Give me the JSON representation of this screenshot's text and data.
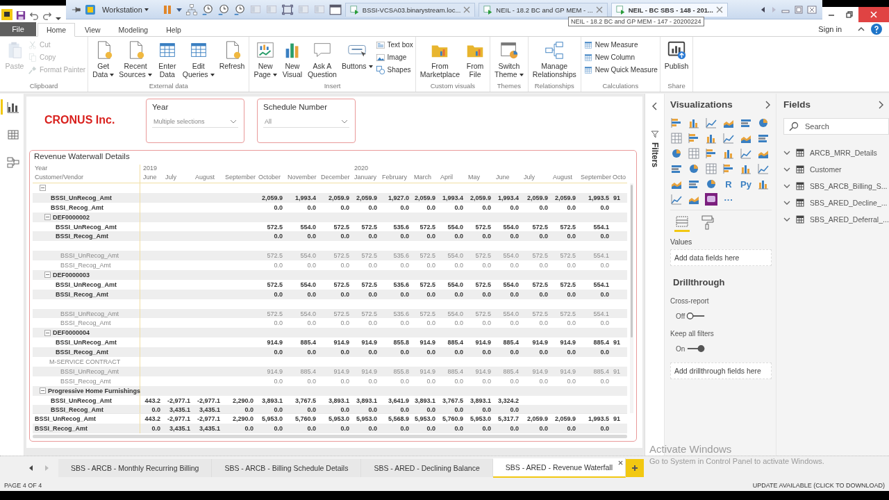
{
  "vm_toolbar": {
    "menu": "Workstation",
    "tabs": [
      {
        "label": "BSSI-VCSA03.binarystream.loc...",
        "selected": false
      },
      {
        "label": "NEIL - 18.2 BC and GP MEM - ...",
        "selected": false
      },
      {
        "label": "NEIL - BC SBS - 148 - 201...",
        "selected": true
      }
    ],
    "tooltip": "NEIL - 18.2 BC and GP MEM - 147 - 20200224"
  },
  "ribbon": {
    "tabs": [
      {
        "label": "File",
        "kind": "file",
        "selected": false
      },
      {
        "label": "Home",
        "kind": "tab",
        "selected": true
      },
      {
        "label": "View",
        "kind": "tab",
        "selected": false
      },
      {
        "label": "Modeling",
        "kind": "tab",
        "selected": false
      },
      {
        "label": "Help",
        "kind": "tab",
        "selected": false
      }
    ],
    "sign_in": "Sign in",
    "groups": [
      {
        "label": "Clipboard",
        "items": [
          {
            "kind": "large",
            "label": "Paste",
            "disabled": true,
            "dropdown": false
          },
          {
            "kind": "stack",
            "items": [
              {
                "label": "Cut",
                "disabled": true
              },
              {
                "label": "Copy",
                "disabled": true
              },
              {
                "label": "Format Painter",
                "disabled": true
              }
            ]
          }
        ]
      },
      {
        "label": "External data",
        "items": [
          {
            "kind": "large",
            "label": "Get\nData",
            "disabled": false,
            "dropdown": true
          },
          {
            "kind": "large",
            "label": "Recent\nSources",
            "disabled": false,
            "dropdown": true
          },
          {
            "kind": "large",
            "label": "Enter\nData",
            "disabled": false,
            "dropdown": false
          },
          {
            "kind": "large",
            "label": "Edit\nQueries",
            "disabled": false,
            "dropdown": true
          },
          {
            "kind": "large",
            "label": "Refresh",
            "disabled": false,
            "dropdown": false
          }
        ]
      },
      {
        "label": "Insert",
        "items": [
          {
            "kind": "large",
            "label": "New\nPage",
            "disabled": false,
            "dropdown": true
          },
          {
            "kind": "large",
            "label": "New\nVisual",
            "disabled": false,
            "dropdown": false
          },
          {
            "kind": "large",
            "label": "Ask A\nQuestion",
            "disabled": false,
            "dropdown": false
          },
          {
            "kind": "large",
            "label": "Buttons",
            "disabled": false,
            "dropdown": true
          },
          {
            "kind": "stack",
            "items": [
              {
                "label": "Text box",
                "disabled": false
              },
              {
                "label": "Image",
                "disabled": false
              },
              {
                "label": "Shapes",
                "disabled": false
              }
            ]
          }
        ]
      },
      {
        "label": "Custom visuals",
        "items": [
          {
            "kind": "large",
            "label": "From\nMarketplace",
            "disabled": false,
            "dropdown": false
          },
          {
            "kind": "large",
            "label": "From\nFile",
            "disabled": false,
            "dropdown": false
          }
        ]
      },
      {
        "label": "Themes",
        "items": [
          {
            "kind": "large",
            "label": "Switch\nTheme",
            "disabled": false,
            "dropdown": true
          }
        ]
      },
      {
        "label": "Relationships",
        "items": [
          {
            "kind": "large",
            "label": "Manage\nRelationships",
            "disabled": false,
            "dropdown": false
          }
        ]
      },
      {
        "label": "Calculations",
        "items": [
          {
            "kind": "stack",
            "items": [
              {
                "label": "New Measure",
                "disabled": false
              },
              {
                "label": "New Column",
                "disabled": false
              },
              {
                "label": "New Quick Measure",
                "disabled": false
              }
            ]
          }
        ]
      },
      {
        "label": "Share",
        "items": [
          {
            "kind": "large",
            "label": "Publish",
            "disabled": false,
            "dropdown": false
          }
        ]
      }
    ]
  },
  "views": [
    {
      "selected": true
    },
    {
      "selected": false
    },
    {
      "selected": false
    }
  ],
  "canvas": {
    "logo": "CRONUS Inc.",
    "slicers": [
      {
        "title": "Year",
        "value": "Multiple selections"
      },
      {
        "title": "Schedule Number",
        "value": "All"
      }
    ],
    "matrix": {
      "title": "Revenue Waterwall Details",
      "row_headers": [
        "Year",
        "Customer/Vendor"
      ],
      "columns": [
        {
          "month": "June",
          "year": "2019"
        },
        {
          "month": "July"
        },
        {
          "month": "August"
        },
        {
          "month": "September"
        },
        {
          "month": "October"
        },
        {
          "month": "November"
        },
        {
          "month": "December"
        },
        {
          "month": "January",
          "year": "2020"
        },
        {
          "month": "February"
        },
        {
          "month": "March"
        },
        {
          "month": "April"
        },
        {
          "month": "May"
        },
        {
          "month": "June"
        },
        {
          "month": "July"
        },
        {
          "month": "August"
        },
        {
          "month": "September"
        },
        {
          "month": "Octo"
        }
      ],
      "rows": [
        {
          "kind": "group",
          "expanded": true,
          "measures": [
            {
              "label": "BSSI_UnRecog_Amt",
              "cells": [
                null,
                null,
                null,
                null,
                "2,059.9",
                "1,993.4",
                "2,059.9",
                "2,059.9",
                "1,927.0",
                "2,059.9",
                "1,993.4",
                "2,059.9",
                "1,993.4",
                "2,059.9",
                "2,059.9",
                "1,993.5",
                "91"
              ]
            },
            {
              "label": "BSSI_Recog_Amt",
              "cells": [
                null,
                null,
                null,
                null,
                "0.0",
                "0.0",
                "0.0",
                "0.0",
                "0.0",
                "0.0",
                "0.0",
                "0.0",
                "0.0",
                "0.0",
                "0.0",
                "0.0",
                null
              ]
            }
          ],
          "children": [
            {
              "kind": "group",
              "label": "DEF0000002",
              "expanded": true,
              "measures": [
                {
                  "label": "BSSI_UnRecog_Amt",
                  "cells": [
                    null,
                    null,
                    null,
                    null,
                    "572.5",
                    "554.0",
                    "572.5",
                    "572.5",
                    "535.6",
                    "572.5",
                    "554.0",
                    "572.5",
                    "554.0",
                    "572.5",
                    "572.5",
                    "554.1",
                    null
                  ]
                },
                {
                  "label": "BSSI_Recog_Amt",
                  "cells": [
                    null,
                    null,
                    null,
                    null,
                    "0.0",
                    "0.0",
                    "0.0",
                    "0.0",
                    "0.0",
                    "0.0",
                    "0.0",
                    "0.0",
                    "0.0",
                    "0.0",
                    "0.0",
                    "0.0",
                    null
                  ]
                }
              ],
              "children": [
                {
                  "kind": "leaf",
                  "measures": [
                    {
                      "label": "BSSI_UnRecog_Amt",
                      "cells": [
                        null,
                        null,
                        null,
                        null,
                        "572.5",
                        "554.0",
                        "572.5",
                        "572.5",
                        "535.6",
                        "572.5",
                        "554.0",
                        "572.5",
                        "554.0",
                        "572.5",
                        "572.5",
                        "554.1",
                        null
                      ]
                    },
                    {
                      "label": "BSSI_Recog_Amt",
                      "cells": [
                        null,
                        null,
                        null,
                        null,
                        "0.0",
                        "0.0",
                        "0.0",
                        "0.0",
                        "0.0",
                        "0.0",
                        "0.0",
                        "0.0",
                        "0.0",
                        "0.0",
                        "0.0",
                        "0.0",
                        null
                      ]
                    }
                  ]
                }
              ]
            },
            {
              "kind": "group",
              "label": "DEF0000003",
              "expanded": true,
              "measures": [
                {
                  "label": "BSSI_UnRecog_Amt",
                  "cells": [
                    null,
                    null,
                    null,
                    null,
                    "572.5",
                    "554.0",
                    "572.5",
                    "572.5",
                    "535.6",
                    "572.5",
                    "554.0",
                    "572.5",
                    "554.0",
                    "572.5",
                    "572.5",
                    "554.1",
                    null
                  ]
                },
                {
                  "label": "BSSI_Recog_Amt",
                  "cells": [
                    null,
                    null,
                    null,
                    null,
                    "0.0",
                    "0.0",
                    "0.0",
                    "0.0",
                    "0.0",
                    "0.0",
                    "0.0",
                    "0.0",
                    "0.0",
                    "0.0",
                    "0.0",
                    "0.0",
                    null
                  ]
                }
              ],
              "children": [
                {
                  "kind": "leaf",
                  "measures": [
                    {
                      "label": "BSSI_UnRecog_Amt",
                      "cells": [
                        null,
                        null,
                        null,
                        null,
                        "572.5",
                        "554.0",
                        "572.5",
                        "572.5",
                        "535.6",
                        "572.5",
                        "554.0",
                        "572.5",
                        "554.0",
                        "572.5",
                        "572.5",
                        "554.1",
                        null
                      ]
                    },
                    {
                      "label": "BSSI_Recog_Amt",
                      "cells": [
                        null,
                        null,
                        null,
                        null,
                        "0.0",
                        "0.0",
                        "0.0",
                        "0.0",
                        "0.0",
                        "0.0",
                        "0.0",
                        "0.0",
                        "0.0",
                        "0.0",
                        "0.0",
                        "0.0",
                        null
                      ]
                    }
                  ]
                }
              ]
            },
            {
              "kind": "group",
              "label": "DEF0000004",
              "expanded": true,
              "measures": [
                {
                  "label": "BSSI_UnRecog_Amt",
                  "cells": [
                    null,
                    null,
                    null,
                    null,
                    "914.9",
                    "885.4",
                    "914.9",
                    "914.9",
                    "855.8",
                    "914.9",
                    "885.4",
                    "914.9",
                    "885.4",
                    "914.9",
                    "914.9",
                    "885.4",
                    "91"
                  ]
                },
                {
                  "label": "BSSI_Recog_Amt",
                  "cells": [
                    null,
                    null,
                    null,
                    null,
                    "0.0",
                    "0.0",
                    "0.0",
                    "0.0",
                    "0.0",
                    "0.0",
                    "0.0",
                    "0.0",
                    "0.0",
                    "0.0",
                    "0.0",
                    "0.0",
                    null
                  ]
                }
              ],
              "children": [
                {
                  "kind": "leaf",
                  "label": "M-SERVICE CONTRACT",
                  "measures": [
                    {
                      "label": "BSSI_UnRecog_Amt",
                      "cells": [
                        null,
                        null,
                        null,
                        null,
                        "914.9",
                        "885.4",
                        "914.9",
                        "914.9",
                        "855.8",
                        "914.9",
                        "885.4",
                        "914.9",
                        "885.4",
                        "914.9",
                        "914.9",
                        "885.4",
                        "91"
                      ]
                    },
                    {
                      "label": "BSSI_Recog_Amt",
                      "cells": [
                        null,
                        null,
                        null,
                        null,
                        "0.0",
                        "0.0",
                        "0.0",
                        "0.0",
                        "0.0",
                        "0.0",
                        "0.0",
                        "0.0",
                        "0.0",
                        "0.0",
                        "0.0",
                        "0.0",
                        null
                      ]
                    }
                  ]
                }
              ]
            }
          ]
        },
        {
          "kind": "group",
          "label": "Progressive Home Furnishings",
          "expanded": true,
          "measures": [
            {
              "label": "BSSI_UnRecog_Amt",
              "cells": [
                "443.2",
                "-2,977.1",
                "-2,977.1",
                "2,290.0",
                "3,893.1",
                "3,767.5",
                "3,893.1",
                "3,893.1",
                "3,641.9",
                "3,893.1",
                "3,767.5",
                "3,893.1",
                "3,324.2",
                null,
                null,
                null,
                null
              ]
            },
            {
              "label": "BSSI_Recog_Amt",
              "cells": [
                "0.0",
                "3,435.1",
                "3,435.1",
                "0.0",
                "0.0",
                "0.0",
                "0.0",
                "0.0",
                "0.0",
                "0.0",
                "0.0",
                "0.0",
                "0.0",
                null,
                null,
                null,
                null
              ]
            }
          ]
        }
      ],
      "totals": [
        {
          "label": "BSSI_UnRecog_Amt",
          "cells": [
            "443.2",
            "-2,977.1",
            "-2,977.1",
            "2,290.0",
            "5,953.0",
            "5,760.9",
            "5,953.0",
            "5,953.0",
            "5,568.9",
            "5,953.0",
            "5,760.9",
            "5,953.0",
            "5,317.7",
            "2,059.9",
            "2,059.9",
            "1,993.5",
            "91"
          ]
        },
        {
          "label": "BSSI_Recog_Amt",
          "cells": [
            "0.0",
            "3,435.1",
            "3,435.1",
            "0.0",
            "0.0",
            "0.0",
            "0.0",
            "0.0",
            "0.0",
            "0.0",
            "0.0",
            "0.0",
            "0.0",
            "0.0",
            "0.0",
            "0.0",
            null
          ]
        }
      ]
    }
  },
  "filters": {
    "label": "Filters"
  },
  "visualizations": {
    "title": "Visualizations",
    "gallery": [
      {
        "kind": "icon",
        "selected": false
      },
      {
        "kind": "icon",
        "selected": false
      },
      {
        "kind": "icon",
        "selected": false
      },
      {
        "kind": "icon",
        "selected": false
      },
      {
        "kind": "icon",
        "selected": false
      },
      {
        "kind": "icon",
        "selected": false
      },
      {
        "kind": "icon",
        "selected": false
      },
      {
        "kind": "icon",
        "selected": false
      },
      {
        "kind": "icon",
        "selected": false
      },
      {
        "kind": "icon",
        "selected": false
      },
      {
        "kind": "icon",
        "selected": false
      },
      {
        "kind": "icon",
        "selected": false
      },
      {
        "kind": "icon",
        "selected": false
      },
      {
        "kind": "icon",
        "selected": false
      },
      {
        "kind": "icon",
        "selected": false
      },
      {
        "kind": "icon",
        "selected": false
      },
      {
        "kind": "icon",
        "selected": false
      },
      {
        "kind": "icon",
        "selected": false
      },
      {
        "kind": "icon",
        "selected": false
      },
      {
        "kind": "icon",
        "selected": false
      },
      {
        "kind": "icon",
        "selected": false
      },
      {
        "kind": "icon",
        "selected": false
      },
      {
        "kind": "icon",
        "selected": false
      },
      {
        "kind": "icon",
        "selected": false
      },
      {
        "kind": "icon",
        "selected": false
      },
      {
        "kind": "icon",
        "selected": false
      },
      {
        "kind": "icon",
        "selected": false
      },
      {
        "kind": "glyph",
        "text": "R",
        "selected": false
      },
      {
        "kind": "glyph",
        "text": "Py",
        "selected": false
      },
      {
        "kind": "icon",
        "selected": false
      },
      {
        "kind": "icon",
        "selected": false
      },
      {
        "kind": "icon",
        "selected": false
      },
      {
        "kind": "icon",
        "selected": true
      },
      {
        "kind": "glyph",
        "text": "···",
        "selected": false
      }
    ],
    "values_label": "Values",
    "values_hint": "Add data fields here",
    "drillthrough_title": "Drillthrough",
    "toggles": [
      {
        "label": "Cross-report",
        "state_label": "Off",
        "on": false
      },
      {
        "label": "Keep all filters",
        "state_label": "On",
        "on": true
      }
    ],
    "drillthrough_hint": "Add drillthrough fields here"
  },
  "fields": {
    "title": "Fields",
    "search": {
      "placeholder": "Search"
    },
    "tables": [
      {
        "name": "ARCB_MRR_Details",
        "expanded": false
      },
      {
        "name": "Customer",
        "expanded": false
      },
      {
        "name": "SBS_ARCB_Billing_S...",
        "expanded": false
      },
      {
        "name": "SBS_ARED_Decline_...",
        "expanded": false
      },
      {
        "name": "SBS_ARED_Deferral_...",
        "expanded": false
      }
    ]
  },
  "page_tabs": [
    {
      "label": "SBS - ARCB - Monthly Recurring Billing",
      "selected": false
    },
    {
      "label": "SBS - ARCB - Billing Schedule Details",
      "selected": false
    },
    {
      "label": "SBS - ARED - Declining Balance",
      "selected": false
    },
    {
      "label": "SBS - ARED - Revenue Waterfall",
      "selected": true
    }
  ],
  "os_notice": {
    "title": "Activate Windows",
    "text": "Go to System in Control Panel to activate Windows."
  },
  "status_bar": {
    "page": "PAGE 4 OF 4",
    "update": "UPDATE AVAILABLE (CLICK TO DOWNLOAD)"
  }
}
